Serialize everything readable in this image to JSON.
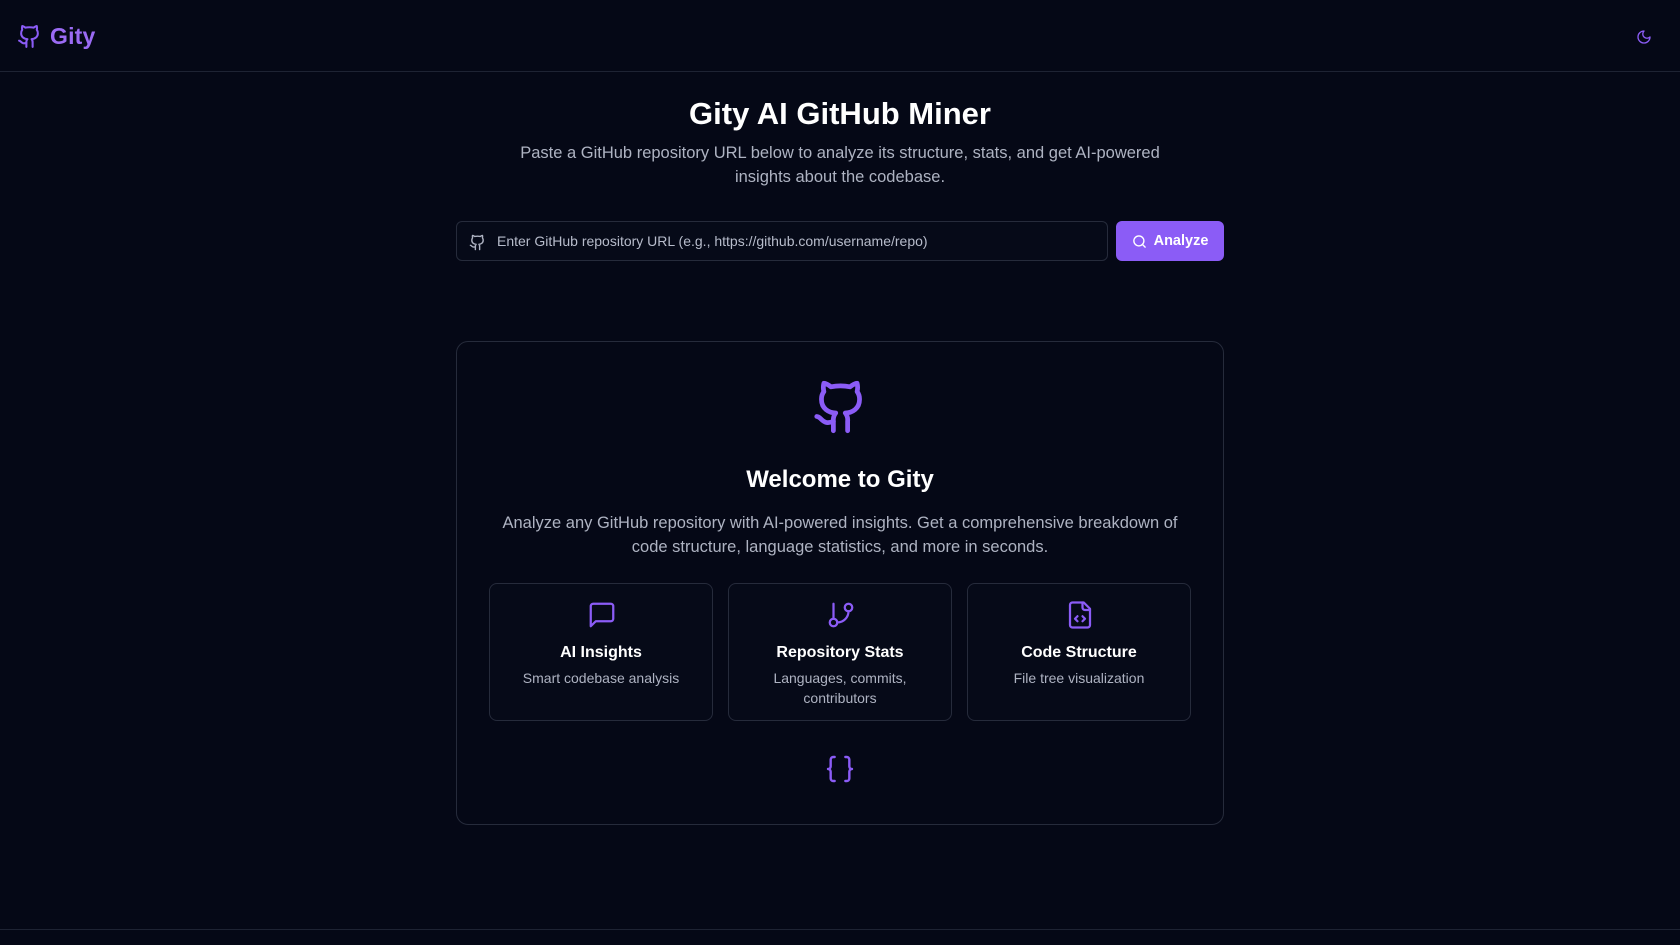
{
  "header": {
    "brand_name": "Gity",
    "brand_icon": "github-icon",
    "theme_toggle_icon": "moon-icon"
  },
  "hero": {
    "title": "Gity AI GitHub Miner",
    "subtitle": "Paste a GitHub repository URL below to analyze its structure, stats, and get AI-powered insights about the codebase."
  },
  "search": {
    "placeholder": "Enter GitHub repository URL (e.g., https://github.com/username/repo)",
    "value": "",
    "icon": "github-icon",
    "button_label": "Analyze",
    "button_icon": "search-icon"
  },
  "welcome": {
    "icon": "github-icon",
    "title": "Welcome to Gity",
    "description": "Analyze any GitHub repository with AI-powered insights. Get a comprehensive breakdown of code structure, language statistics, and more in seconds.",
    "features": [
      {
        "icon": "message-square-icon",
        "title": "AI Insights",
        "description": "Smart codebase analysis"
      },
      {
        "icon": "git-branch-icon",
        "title": "Repository Stats",
        "description": "Languages, commits, contributors"
      },
      {
        "icon": "file-code-icon",
        "title": "Code Structure",
        "description": "File tree visualization"
      }
    ],
    "footer_icon": "braces-icon"
  },
  "colors": {
    "background": "#050816",
    "accent": "#8b5cf6",
    "border": "#262b3b",
    "muted_text": "#aeb3c2"
  }
}
